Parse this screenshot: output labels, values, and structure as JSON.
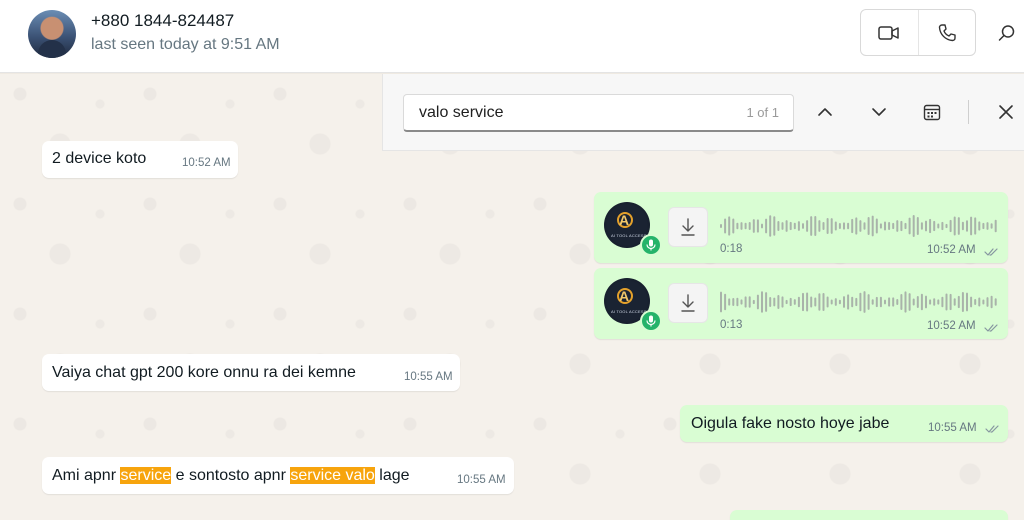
{
  "header": {
    "contact_name": "+880 1844-824487",
    "contact_status": "last seen today at 9:51 AM",
    "icons": {
      "avatar": "contact-avatar",
      "video": "video-call-icon",
      "voice": "voice-call-icon",
      "search": "search-icon"
    }
  },
  "search": {
    "query": "valo service",
    "count": "1 of 1",
    "icons": [
      "chevron-up-icon",
      "chevron-down-icon",
      "calendar-icon",
      "close-icon"
    ]
  },
  "messages": [
    {
      "direction": "incoming",
      "text": "2 device koto",
      "time": "10:52 AM"
    },
    {
      "direction": "outgoing",
      "type": "voice",
      "duration": "0:18",
      "time": "10:52 AM",
      "read": true
    },
    {
      "direction": "outgoing",
      "type": "voice",
      "duration": "0:13",
      "time": "10:52 AM",
      "read": true
    },
    {
      "direction": "incoming",
      "text": "Vaiya chat gpt 200 kore onnu ra dei kemne",
      "time": "10:55 AM"
    },
    {
      "direction": "outgoing",
      "text": "Oigula fake nosto hoye jabe",
      "time": "10:55 AM",
      "read": true
    },
    {
      "direction": "incoming",
      "parts": [
        "Ami apnr ",
        "service",
        " e sontosto apnr ",
        "service valo",
        " lage"
      ],
      "time": "10:55 AM"
    }
  ],
  "voice_avatar_label": "AI TOOL ACCESS",
  "colors": {
    "outgoing_bubble": "#d9fdd3",
    "incoming_bubble": "#ffffff",
    "highlight": "#f7a40d",
    "mic_badge": "#25b36a"
  }
}
